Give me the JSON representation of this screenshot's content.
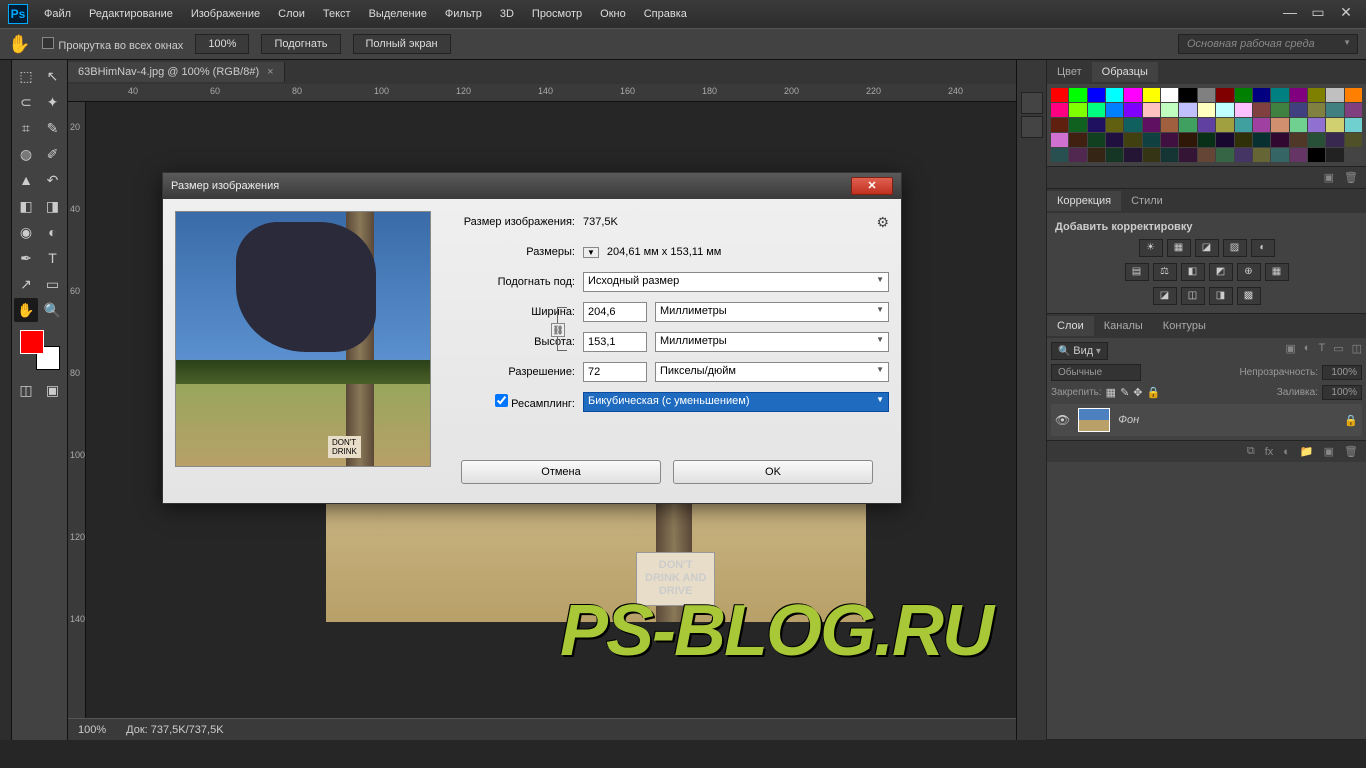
{
  "menu": {
    "items": [
      "Файл",
      "Редактирование",
      "Изображение",
      "Слои",
      "Текст",
      "Выделение",
      "Фильтр",
      "3D",
      "Просмотр",
      "Окно",
      "Справка"
    ]
  },
  "optbar": {
    "scroll": "Прокрутка во всех окнах",
    "zoom": "100%",
    "fit": "Подогнать",
    "full": "Полный экран",
    "workspace": "Основная рабочая среда"
  },
  "doc": {
    "tab": "63BHimNav-4.jpg @ 100% (RGB/8#)"
  },
  "ruler_h": [
    "40",
    "60",
    "80",
    "100",
    "120",
    "140",
    "160",
    "180",
    "200",
    "220",
    "240"
  ],
  "ruler_v": [
    "20",
    "40",
    "60",
    "80",
    "100",
    "120",
    "140"
  ],
  "sign": {
    "l1": "DON'T",
    "l2": "DRINK AND",
    "l3": "DRIVE"
  },
  "status": {
    "zoom": "100%",
    "doc": "Док: 737,5K/737,5K"
  },
  "panels": {
    "color": {
      "tabs": [
        "Цвет",
        "Образцы"
      ]
    },
    "corr": {
      "tabs": [
        "Коррекция",
        "Стили"
      ],
      "add": "Добавить корректировку"
    },
    "layers": {
      "tabs": [
        "Слои",
        "Каналы",
        "Контуры"
      ],
      "kind": "Вид",
      "blend": "Обычные",
      "opacity_lbl": "Непрозрачность:",
      "opacity": "100%",
      "lock_lbl": "Закрепить:",
      "fill_lbl": "Заливка:",
      "fill": "100%",
      "layer_name": "Фон"
    }
  },
  "dialog": {
    "title": "Размер изображения",
    "size_lbl": "Размер изображения:",
    "size": "737,5K",
    "dim_lbl": "Размеры:",
    "dim": "204,61 мм x 153,11 мм",
    "fit_lbl": "Подогнать под:",
    "fit": "Исходный размер",
    "w_lbl": "Ширина:",
    "w": "204,6",
    "w_unit": "Миллиметры",
    "h_lbl": "Высота:",
    "h": "153,1",
    "h_unit": "Миллиметры",
    "res_lbl": "Разрешение:",
    "res": "72",
    "res_unit": "Пикселы/дюйм",
    "resamp_lbl": "Ресамплинг:",
    "resamp": "Бикубическая (с уменьшением)",
    "cancel": "Отмена",
    "ok": "OK"
  },
  "watermark": "PS-BLOG.RU",
  "swatch_colors": [
    "#f00",
    "#0f0",
    "#00f",
    "#0ff",
    "#f0f",
    "#ff0",
    "#fff",
    "#000",
    "#808080",
    "#800000",
    "#008000",
    "#000080",
    "#008080",
    "#800080",
    "#808000",
    "#c0c0c0",
    "#ff8000",
    "#ff0080",
    "#80ff00",
    "#00ff80",
    "#0080ff",
    "#8000ff",
    "#ffc0c0",
    "#c0ffc0",
    "#c0c0ff",
    "#ffffc0",
    "#c0ffff",
    "#ffc0ff",
    "#804040",
    "#408040",
    "#404080",
    "#808040",
    "#408080",
    "#804080",
    "#602010",
    "#106020",
    "#201060",
    "#606010",
    "#106060",
    "#601060",
    "#a06040",
    "#40a060",
    "#6040a0",
    "#a0a040",
    "#40a0a0",
    "#a040a0",
    "#d09070",
    "#70d090",
    "#9070d0",
    "#d0d070",
    "#70d0d0",
    "#d070d0",
    "#402010",
    "#104020",
    "#201040",
    "#404010",
    "#104040",
    "#401040",
    "#301808",
    "#083018",
    "#180830",
    "#303008",
    "#083030",
    "#300830",
    "#503828",
    "#285038",
    "#382850",
    "#505028",
    "#285050",
    "#502850",
    "#352515",
    "#153525",
    "#251535",
    "#353515",
    "#153535",
    "#351535",
    "#654535",
    "#356545",
    "#453565",
    "#656535",
    "#356565",
    "#653565",
    "#000",
    "#222",
    "#444",
    "#666",
    "#888",
    "#aaa"
  ]
}
